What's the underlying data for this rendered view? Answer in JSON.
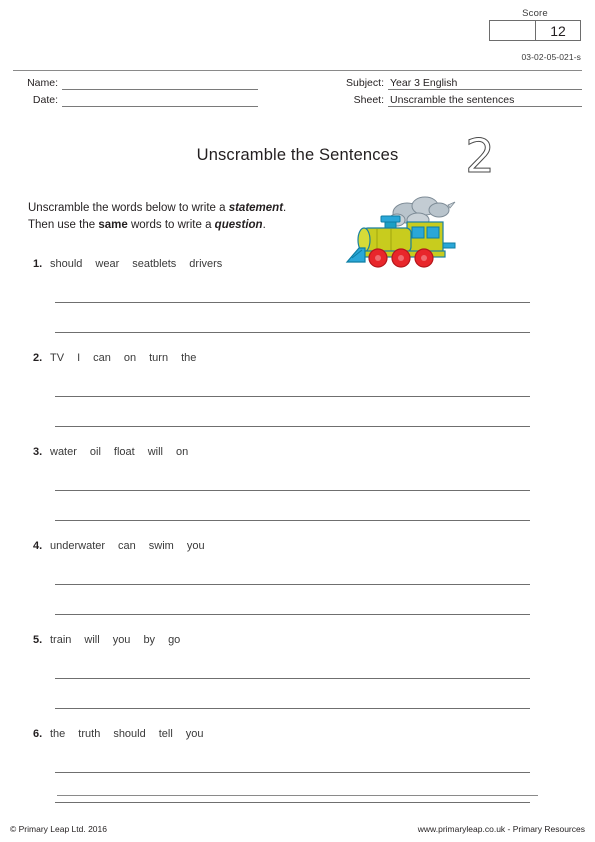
{
  "score": {
    "label": "Score",
    "blank_cell": "",
    "value": "12"
  },
  "sheet_code": "03-02-05-021-s",
  "meta": {
    "name_label": "Name:",
    "name_value": "",
    "date_label": "Date:",
    "date_value": "",
    "subject_label": "Subject:",
    "subject_value": "Year 3 English",
    "sheet_label": "Sheet:",
    "sheet_value": "Unscramble the sentences"
  },
  "title": "Unscramble the Sentences",
  "big_number": "2",
  "instructions": {
    "line1_a": "Unscramble the words below to write a ",
    "line1_b": "statement",
    "line1_c": ".",
    "line2_a": "Then use the ",
    "line2_b": "same",
    "line2_c": " words to write a ",
    "line2_d": "question",
    "line2_e": "."
  },
  "illustration": {
    "name": "steam-train",
    "colors": {
      "body": "#c8cc1e",
      "body_shade": "#a8ac12",
      "accent": "#1b9fc4",
      "accent_dark": "#0d7ea3",
      "window": "#2aa7d8",
      "wheel": "#e8262b",
      "wheel_dark": "#b5161b",
      "smoke": "#b9c4cc",
      "smoke_line": "#7d8b96",
      "outline": "#1a7fa0"
    }
  },
  "questions": [
    {
      "number": "1.",
      "words": [
        "should",
        "wear",
        "seatblets",
        "drivers"
      ]
    },
    {
      "number": "2.",
      "words": [
        "TV",
        "I",
        "can",
        "on",
        "turn",
        "the"
      ]
    },
    {
      "number": "3.",
      "words": [
        "water",
        "oil",
        "float",
        "will",
        "on"
      ]
    },
    {
      "number": "4.",
      "words": [
        "underwater",
        "can",
        "swim",
        "you"
      ]
    },
    {
      "number": "5.",
      "words": [
        "train",
        "will",
        "you",
        "by",
        "go"
      ]
    },
    {
      "number": "6.",
      "words": [
        "the",
        "truth",
        "should",
        "tell",
        "you"
      ]
    }
  ],
  "footer": {
    "left": "© Primary Leap Ltd. 2016",
    "right": "www.primaryleap.co.uk -  Primary Resources"
  }
}
